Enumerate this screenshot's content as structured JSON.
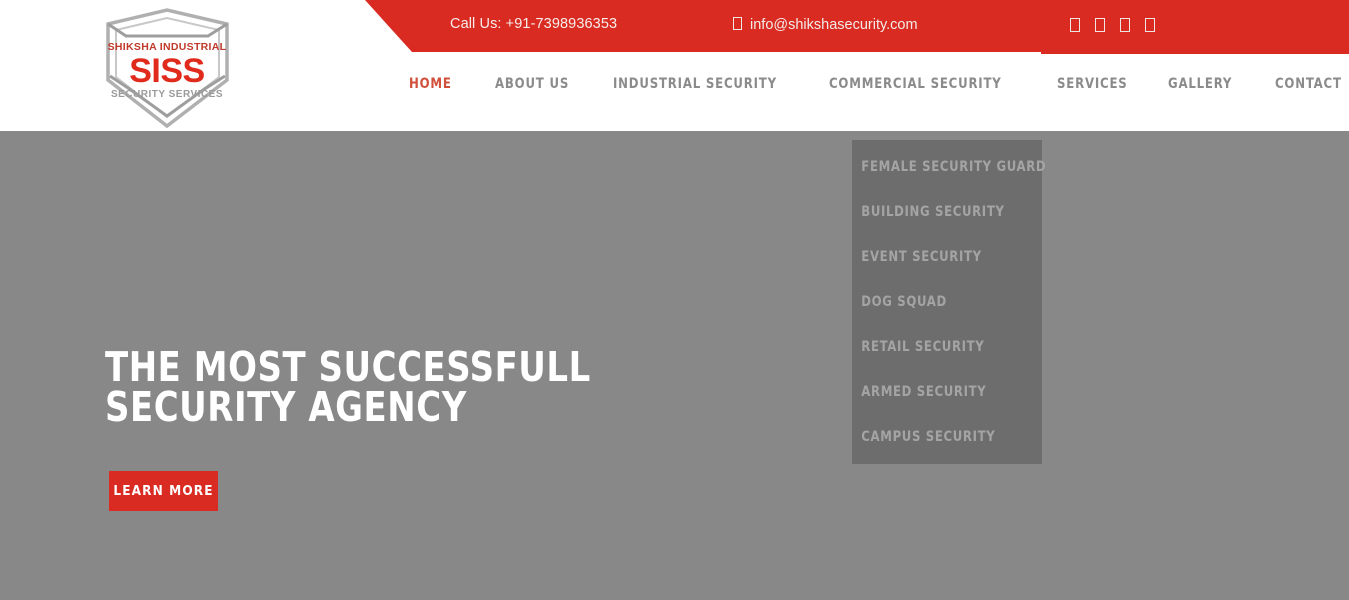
{
  "colors": {
    "brand_red": "#d92b21",
    "nav_inactive": "#8c8b8b",
    "nav_active": "#d1503c",
    "hero_overlay": "#888888",
    "dropdown_bg": "#6d6d6d",
    "dropdown_text": "#a5a4a4"
  },
  "topbar": {
    "phone_label": "Call Us: +91-7398936353",
    "email": "info@shikshasecurity.com",
    "email_icon": "envelope-icon",
    "social": [
      {
        "name": "facebook-icon",
        "glyph": "□"
      },
      {
        "name": "twitter-icon",
        "glyph": "□"
      },
      {
        "name": "google-plus-icon",
        "glyph": "□"
      },
      {
        "name": "linkedin-icon",
        "glyph": "□"
      }
    ]
  },
  "logo": {
    "line1": "SHIKSHA INDUSTRIAL",
    "line2": "SISS",
    "line3": "SECURITY SERVICES",
    "shape": "shield-icon"
  },
  "nav": {
    "items": [
      {
        "label": "HOME",
        "active": true
      },
      {
        "label": "ABOUT US",
        "active": false
      },
      {
        "label": "INDUSTRIAL SECURITY",
        "active": false
      },
      {
        "label": "COMMERCIAL SECURITY",
        "active": false
      },
      {
        "label": "SERVICES",
        "active": false
      },
      {
        "label": "GALLERY",
        "active": false
      },
      {
        "label": "CONTACT",
        "active": false
      }
    ]
  },
  "hero": {
    "title": "THE MOST SUCCESSFULL SECURITY AGENCY",
    "cta_label": "LEARN MORE"
  },
  "dropdown": {
    "items": [
      {
        "label": "FEMALE SECURITY GUARD"
      },
      {
        "label": "BUILDING SECURITY"
      },
      {
        "label": "EVENT SECURITY"
      },
      {
        "label": "DOG SQUAD"
      },
      {
        "label": "RETAIL SECURITY"
      },
      {
        "label": "ARMED SECURITY"
      },
      {
        "label": "CAMPUS SECURITY"
      }
    ]
  }
}
